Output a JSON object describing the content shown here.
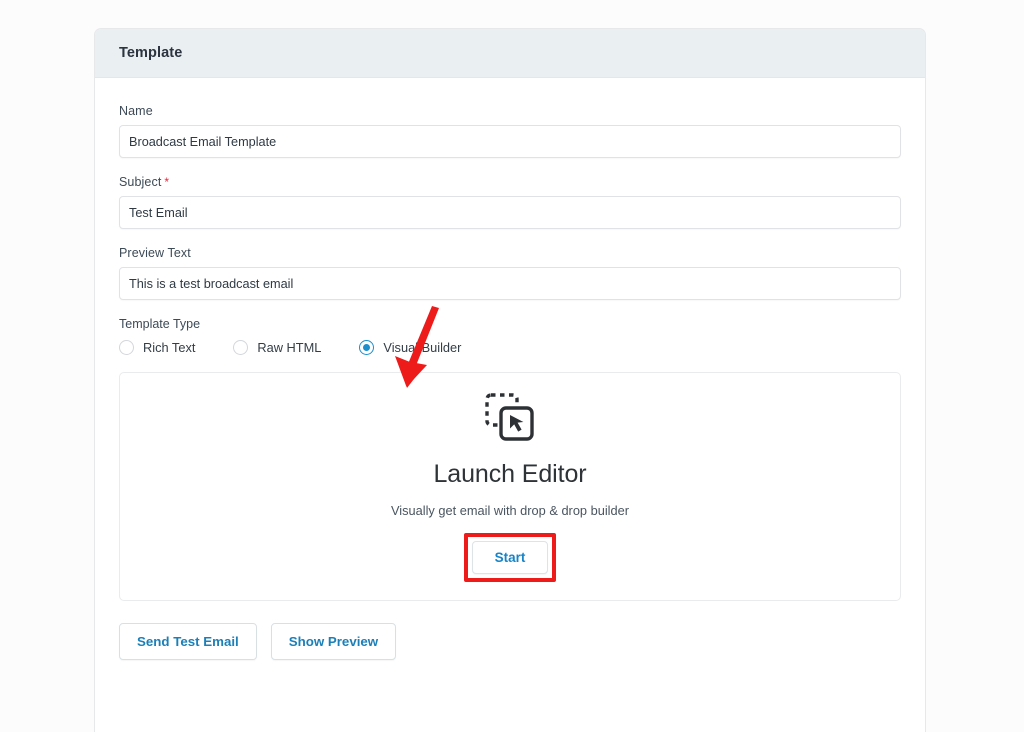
{
  "card": {
    "header_title": "Template"
  },
  "form": {
    "name": {
      "label": "Name",
      "value": "Broadcast Email Template",
      "placeholder": "Name"
    },
    "subject": {
      "label": "Subject",
      "required_mark": "*",
      "value": "Test Email",
      "placeholder": "Subject"
    },
    "preview_text": {
      "label": "Preview Text",
      "value": "This is a test broadcast email",
      "placeholder": "Preview Text"
    },
    "template_type": {
      "label": "Template Type",
      "selected": "Visual Builder",
      "options": [
        {
          "label": "Rich Text",
          "selected": false
        },
        {
          "label": "Raw HTML",
          "selected": false
        },
        {
          "label": "Visual Builder",
          "selected": true
        }
      ]
    }
  },
  "launch_panel": {
    "icon": "drag-drop-cursor-icon",
    "title": "Launch Editor",
    "subtitle": "Visually get email with drop & drop builder",
    "start_label": "Start"
  },
  "actions": {
    "send_test_email_label": "Send Test Email",
    "show_preview_label": "Show Preview"
  },
  "annotations": {
    "arrow": "red-arrow-pointing-to-visual-builder",
    "highlight": "red-box-around-start-button"
  },
  "colors": {
    "header_bg": "#eaeff1",
    "accent_blue": "#1a8fcc",
    "link_blue": "#1b7fb8",
    "annotation_red": "#ee1b1b",
    "required_red": "#e02c3c",
    "text_dark": "#2e3338",
    "border": "#e6e8ea",
    "page_bg": "#fcfcfd"
  }
}
